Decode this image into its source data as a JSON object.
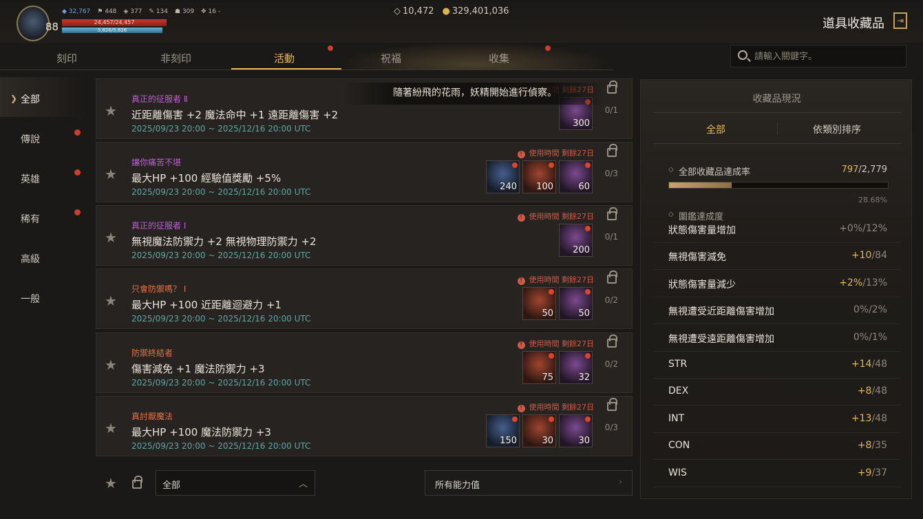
{
  "player": {
    "level": "88",
    "stat1": "32,767",
    "stat2": "448",
    "stat3": "377",
    "stat4": "134",
    "stat5": "309",
    "stat6": "16 -",
    "hp": "24,457/24,457",
    "mp": "5,826/5,826"
  },
  "currency": {
    "gems": "10,472",
    "gold": "329,401,036"
  },
  "title": "道具收藏品",
  "tabs": [
    "刻印",
    "非刻印",
    "活動",
    "祝福",
    "收集"
  ],
  "banner_text": "隨著紛飛的花雨，妖精開始進行偵察。",
  "search": {
    "placeholder": "請輸入關鍵字。"
  },
  "sidebar": [
    "全部",
    "傳說",
    "英雄",
    "稀有",
    "高級",
    "一般"
  ],
  "cards": [
    {
      "name": "真正的征服者 Ⅱ",
      "name_color": "#c05ed9",
      "desc": "近距離傷害 +2 魔法命中 +1 遠距離傷害 +2",
      "date": "2025/09/23 20:00 ~ 2025/12/16 20:00 UTC",
      "warn": "使用時間 剩餘27日",
      "count": "0/1",
      "slots": [
        {
          "color": "purple",
          "qty": "300"
        }
      ]
    },
    {
      "name": "讓你痛苦不堪",
      "name_color": "#c05ed9",
      "desc": "最大HP +100 經驗值獎勵 +5%",
      "date": "2025/09/23 20:00 ~ 2025/12/16 20:00 UTC",
      "warn": "使用時間 剩餘27日",
      "count": "0/3",
      "slots": [
        {
          "color": "blue",
          "qty": "240"
        },
        {
          "color": "red",
          "qty": "100"
        },
        {
          "color": "purple",
          "qty": "60"
        }
      ]
    },
    {
      "name": "真正的征服者 Ⅰ",
      "name_color": "#c05ed9",
      "desc": "無視魔法防禦力 +2 無視物理防禦力 +2",
      "date": "2025/09/23 20:00 ~ 2025/12/16 20:00 UTC",
      "warn": "使用時間 剩餘27日",
      "count": "0/1",
      "slots": [
        {
          "color": "purple",
          "qty": "200"
        }
      ]
    },
    {
      "name": "只會防禦嗎？ Ⅰ",
      "name_color": "#e0744e",
      "desc": "最大HP +100 近距離迴避力 +1",
      "date": "2025/09/23 20:00 ~ 2025/12/16 20:00 UTC",
      "warn": "使用時間 剩餘27日",
      "count": "0/2",
      "slots": [
        {
          "color": "red",
          "qty": "50"
        },
        {
          "color": "purple",
          "qty": "50"
        }
      ]
    },
    {
      "name": "防禦終結者",
      "name_color": "#e0744e",
      "desc": "傷害減免 +1 魔法防禦力 +3",
      "date": "2025/09/23 20:00 ~ 2025/12/16 20:00 UTC",
      "warn": "使用時間 剩餘27日",
      "count": "0/2",
      "slots": [
        {
          "color": "red",
          "qty": "75"
        },
        {
          "color": "purple",
          "qty": "32"
        }
      ]
    },
    {
      "name": "真討厭魔法",
      "name_color": "#e0744e",
      "desc": "最大HP +100 魔法防禦力 +3",
      "date": "2025/09/23 20:00 ~ 2025/12/16 20:00 UTC",
      "warn": "使用時間 剩餘27日",
      "count": "0/3",
      "slots": [
        {
          "color": "blue",
          "qty": "150"
        },
        {
          "color": "red",
          "qty": "30"
        },
        {
          "color": "purple",
          "qty": "30"
        }
      ]
    }
  ],
  "filters": {
    "category": "全部",
    "stat": "所有能力值"
  },
  "panel": {
    "title": "收藏品現況",
    "tab_all": "全部",
    "tab_sort": "依類別排序",
    "rate_label": "全部收藏品達成率",
    "rate_done": "797",
    "rate_total": "/2,779",
    "rate_fraction": 0.2868,
    "rate_pct": "28.68%",
    "codex_label": "圖鑑達成度",
    "stats": [
      {
        "name": "狀態傷害量增加",
        "cur": "+0%",
        "max": "/12%",
        "up": false
      },
      {
        "name": "無視傷害減免",
        "cur": "+10",
        "max": "/84",
        "up": true
      },
      {
        "name": "狀態傷害量減少",
        "cur": "+2%",
        "max": "/13%",
        "up": true
      },
      {
        "name": "無視遭受近距離傷害增加",
        "cur": "0%",
        "max": "/2%",
        "up": false
      },
      {
        "name": "無視遭受遠距離傷害增加",
        "cur": "0%",
        "max": "/1%",
        "up": false
      },
      {
        "name": "STR",
        "cur": "+14",
        "max": "/48",
        "up": true
      },
      {
        "name": "DEX",
        "cur": "+8",
        "max": "/48",
        "up": true
      },
      {
        "name": "INT",
        "cur": "+13",
        "max": "/48",
        "up": true
      },
      {
        "name": "CON",
        "cur": "+8",
        "max": "/35",
        "up": true
      },
      {
        "name": "WIS",
        "cur": "+9",
        "max": "/37",
        "up": true
      }
    ]
  }
}
